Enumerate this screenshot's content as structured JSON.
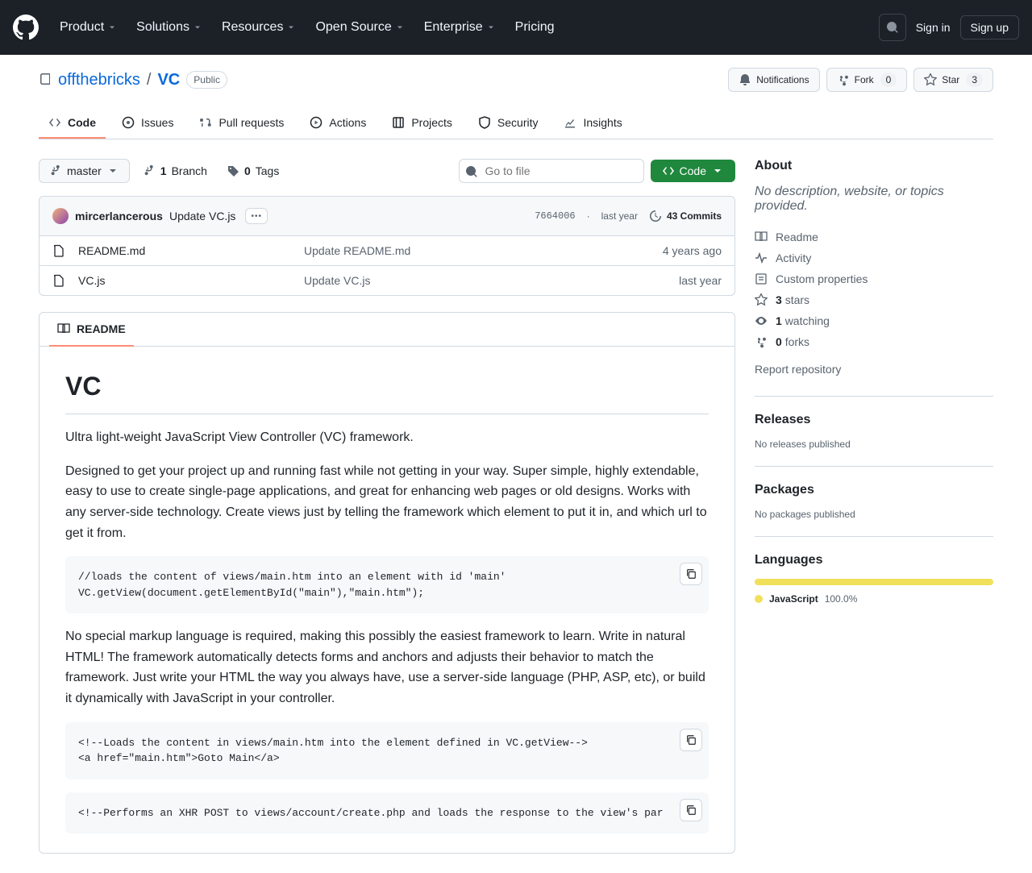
{
  "header": {
    "nav": [
      "Product",
      "Solutions",
      "Resources",
      "Open Source",
      "Enterprise",
      "Pricing"
    ],
    "nav_has_dropdown": [
      true,
      true,
      true,
      true,
      true,
      false
    ],
    "signin": "Sign in",
    "signup": "Sign up"
  },
  "repo": {
    "owner": "offthebricks",
    "name": "VC",
    "visibility": "Public",
    "notifications": "Notifications",
    "fork": "Fork",
    "fork_count": "0",
    "star": "Star",
    "star_count": "3"
  },
  "tabs": [
    {
      "label": "Code",
      "active": true,
      "icon": "code"
    },
    {
      "label": "Issues",
      "active": false,
      "icon": "issues"
    },
    {
      "label": "Pull requests",
      "active": false,
      "icon": "pr"
    },
    {
      "label": "Actions",
      "active": false,
      "icon": "play"
    },
    {
      "label": "Projects",
      "active": false,
      "icon": "project"
    },
    {
      "label": "Security",
      "active": false,
      "icon": "shield"
    },
    {
      "label": "Insights",
      "active": false,
      "icon": "graph"
    }
  ],
  "toolbar": {
    "branch": "master",
    "branches_n": "1",
    "branches_label": "Branch",
    "tags_n": "0",
    "tags_label": "Tags",
    "search_placeholder": "Go to file",
    "code_btn": "Code"
  },
  "commit": {
    "author": "mircerlancerous",
    "message": "Update VC.js",
    "sha": "7664006",
    "time": "last year",
    "commits_count": "43 Commits"
  },
  "files": [
    {
      "name": "README.md",
      "msg": "Update README.md",
      "date": "4 years ago"
    },
    {
      "name": "VC.js",
      "msg": "Update VC.js",
      "date": "last year"
    }
  ],
  "readme": {
    "tab": "README",
    "title": "VC",
    "p1": "Ultra light-weight JavaScript View Controller (VC) framework.",
    "p2": "Designed to get your project up and running fast while not getting in your way. Super simple, highly extendable, easy to use to create single-page applications, and great for enhancing web pages or old designs. Works with any server-side technology. Create views just by telling the framework which element to put it in, and which url to get it from.",
    "code1": "//loads the content of views/main.htm into an element with id 'main'\nVC.getView(document.getElementById(\"main\"),\"main.htm\");",
    "p3": "No special markup language is required, making this possibly the easiest framework to learn. Write in natural HTML! The framework automatically detects forms and anchors and adjusts their behavior to match the framework. Just write your HTML the way you always have, use a server-side language (PHP, ASP, etc), or build it dynamically with JavaScript in your controller.",
    "code2": "<!--Loads the content in views/main.htm into the element defined in VC.getView-->\n<a href=\"main.htm\">Goto Main</a>",
    "code3": "<!--Performs an XHR POST to views/account/create.php and loads the response to the view's par"
  },
  "about": {
    "heading": "About",
    "desc": "No description, website, or topics provided.",
    "readme": "Readme",
    "activity": "Activity",
    "custom": "Custom properties",
    "stars_n": "3",
    "stars_label": "stars",
    "watching_n": "1",
    "watching_label": "watching",
    "forks_n": "0",
    "forks_label": "forks",
    "report": "Report repository"
  },
  "releases": {
    "heading": "Releases",
    "none": "No releases published"
  },
  "packages": {
    "heading": "Packages",
    "none": "No packages published"
  },
  "languages": {
    "heading": "Languages",
    "lang": "JavaScript",
    "pct": "100.0%",
    "color": "#f1e05a"
  }
}
